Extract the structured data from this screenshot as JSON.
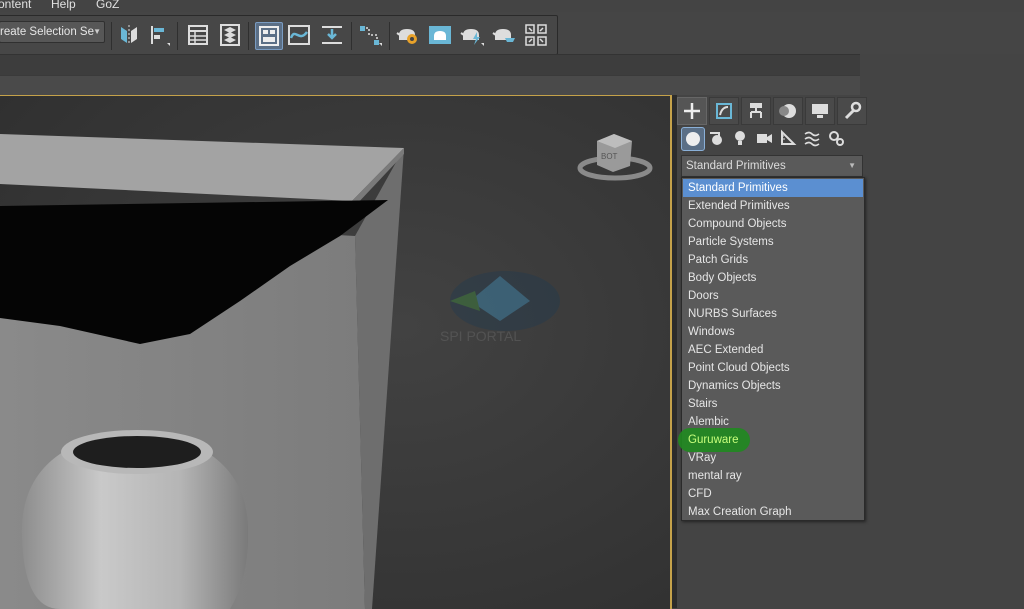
{
  "menu": {
    "items": [
      "ontent",
      "Help",
      "GoZ"
    ]
  },
  "toolbar": {
    "selection_set_label": "reate Selection Se",
    "icons": [
      "mirror-icon",
      "align-icon",
      "scene-explorer-icon",
      "layer-explorer-icon",
      "ribbon-toggle-icon",
      "curve-editor-icon",
      "dope-sheet-icon",
      "schematic-view-icon",
      "render-setup-icon",
      "rendered-frame-icon",
      "render-production-icon",
      "render-iterative-icon",
      "quick-render-icon"
    ]
  },
  "viewport": {
    "viewcube_label": "BOT",
    "watermark_text": "SPI PORTAL"
  },
  "command_panel": {
    "tabs": [
      "create-tab",
      "modify-tab",
      "hierarchy-tab",
      "motion-tab",
      "display-tab",
      "utilities-tab"
    ],
    "categories": [
      "geometry-icon",
      "shapes-icon",
      "lights-icon",
      "cameras-icon",
      "helpers-icon",
      "space-warps-icon",
      "systems-icon"
    ],
    "dropdown_value": "Standard Primitives",
    "options": [
      "Standard Primitives",
      "Extended Primitives",
      "Compound Objects",
      "Particle Systems",
      "Patch Grids",
      "Body Objects",
      "Doors",
      "NURBS Surfaces",
      "Windows",
      "AEC Extended",
      "Point Cloud Objects",
      "Dynamics Objects",
      "Stairs",
      "Alembic",
      "Guruware",
      "VRay",
      "mental ray",
      "CFD",
      "Max Creation Graph"
    ],
    "selected_option": "Standard Primitives",
    "highlighted_option": "Guruware"
  },
  "colors": {
    "selection_blue": "#5b8fd1",
    "viewport_border": "#c5a24a",
    "highlight_green": "#1f8a1f"
  }
}
